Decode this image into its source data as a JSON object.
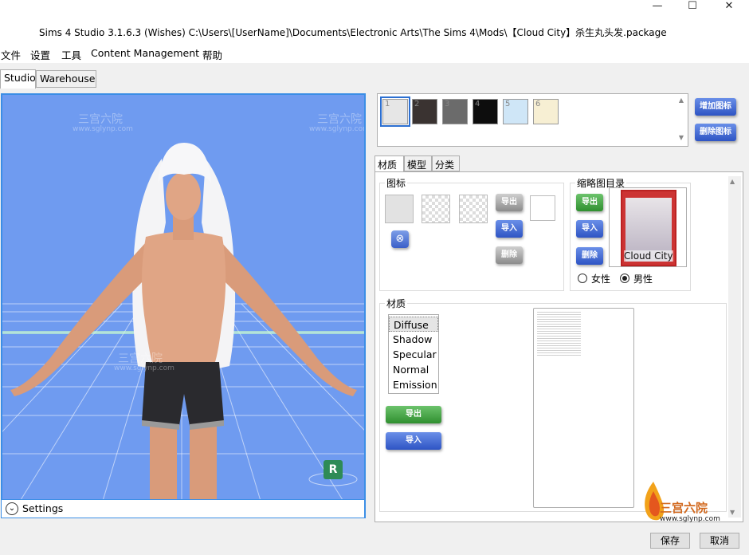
{
  "window": {
    "title": "Sims 4 Studio 3.1.6.3 (Wishes)  C:\\Users\\[UserName]\\Documents\\Electronic Arts\\The Sims 4\\Mods\\【Cloud City】杀生丸头发.package",
    "minimize": "—",
    "maximize": "☐",
    "close": "✕"
  },
  "menu": [
    "文件",
    "设置",
    "工具",
    "Content Management",
    "帮助"
  ],
  "tabs": [
    "Studio",
    "Warehouse"
  ],
  "viewport": {
    "settings_label": "Settings",
    "watermark": "三宫六院",
    "watermark_url": "www.sglynp.com",
    "gizmo_letter": "R"
  },
  "swatches": [
    {
      "num": "1",
      "color": "#e6e6e6"
    },
    {
      "num": "2",
      "color": "#3a3331"
    },
    {
      "num": "3",
      "color": "#6b6b6b"
    },
    {
      "num": "4",
      "color": "#0d0d0d"
    },
    {
      "num": "5",
      "color": "#cfe6f7"
    },
    {
      "num": "6",
      "color": "#f7efd3"
    }
  ],
  "swatch_buttons": {
    "add": "增加图标",
    "remove": "删除图标"
  },
  "subtabs": [
    "材质",
    "模型",
    "分类"
  ],
  "icon_group": {
    "title": "图标",
    "export": "导出",
    "import": "导入",
    "delete": "删除"
  },
  "thumbnail_group": {
    "title": "缩略图目录",
    "export": "导出",
    "import": "导入",
    "delete": "删除",
    "thumbnail_caption": "Cloud City",
    "female": "女性",
    "male": "男性"
  },
  "material_group": {
    "title": "材质",
    "items": [
      "Diffuse",
      "Shadow",
      "Specular",
      "Normal",
      "Emission"
    ],
    "export": "导出",
    "import": "导入"
  },
  "footer": {
    "save": "保存",
    "cancel": "取消"
  },
  "corner_watermark": {
    "name": "三宫六院",
    "url": "www.sglynp.com"
  }
}
